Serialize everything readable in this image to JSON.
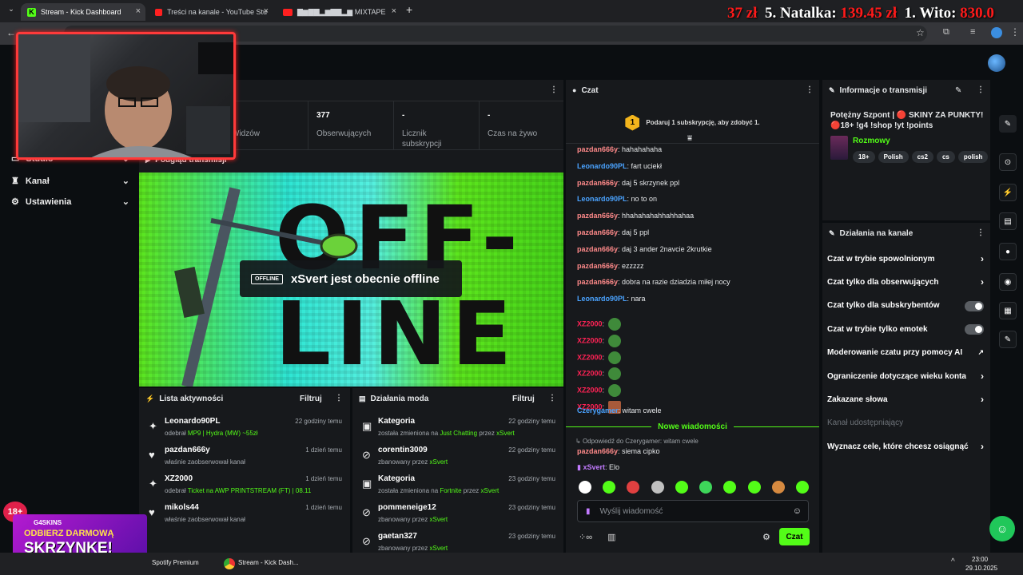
{
  "browser": {
    "tabs": [
      {
        "title": "Stream - Kick Dashboard",
        "active": true
      },
      {
        "title": "Treści na kanale - YouTube Stu",
        "active": false
      },
      {
        "title": "▇▆▇▇▂▆▇▇▂▆ MIXTAPE",
        "active": false
      }
    ],
    "new_tab": "+",
    "rank_overlay": {
      "seg1_amount": "37 zł",
      "seg2_label": "5. Natalka:",
      "seg2_amount": "139.45 zł",
      "seg3_label": "1. Wito:",
      "seg3_amount": "830.0"
    }
  },
  "stats": [
    {
      "value": "",
      "label": "Widzów"
    },
    {
      "value": "377",
      "label": "Obserwujących"
    },
    {
      "value": "-",
      "label": "Licznik subskrypcji"
    },
    {
      "value": "-",
      "label": "Czas na żywo"
    }
  ],
  "nav": {
    "items": [
      {
        "label": "Studio"
      },
      {
        "label": "Kanał"
      },
      {
        "label": "Ustawienia"
      }
    ]
  },
  "preview": {
    "title": "Podgląd transmisji",
    "offline_tag": "OFFLINE",
    "offline_text": "xSvert jest obecnie offline",
    "bg_text_1": "OFF-",
    "bg_text_2": "LINE"
  },
  "activity": {
    "title": "Lista aktywności",
    "filter": "Filtruj",
    "items": [
      {
        "name": "Leonardo90PL",
        "time": "22 godziny temu",
        "pre": "odebrał ",
        "hl": "MP9 | Hydra (MW) ~55zł"
      },
      {
        "name": "pazdan666y",
        "time": "1 dzień temu",
        "pre": "właśnie zaobserwował kanał",
        "hl": ""
      },
      {
        "name": "XZ2000",
        "time": "1 dzień temu",
        "pre": "odebrał ",
        "hl": "Ticket na AWP PRINTSTREAM (FT) | 08.11"
      },
      {
        "name": "mikols44",
        "time": "1 dzień temu",
        "pre": "właśnie zaobserwował kanał",
        "hl": ""
      }
    ]
  },
  "modactions": {
    "title": "Działania moda",
    "filter": "Filtruj",
    "items": [
      {
        "name": "Kategoria",
        "time": "22 godziny temu",
        "pre": "została zmieniona na ",
        "hl": "Just Chatting",
        "mid": " przez ",
        "hl2": "xSvert"
      },
      {
        "name": "corentin3009",
        "time": "22 godziny temu",
        "pre": "zbanowany przez ",
        "hl": "xSvert",
        "mid": "",
        "hl2": ""
      },
      {
        "name": "Kategoria",
        "time": "23 godziny temu",
        "pre": "została zmieniona na ",
        "hl": "Fortnite",
        "mid": " przez ",
        "hl2": "xSvert"
      },
      {
        "name": "pommeneige12",
        "time": "23 godziny temu",
        "pre": "zbanowany przez ",
        "hl": "xSvert",
        "mid": "",
        "hl2": ""
      },
      {
        "name": "gaetan327",
        "time": "23 godziny temu",
        "pre": "zbanowany przez ",
        "hl": "xSvert",
        "mid": "",
        "hl2": ""
      }
    ]
  },
  "chat": {
    "title": "Czat",
    "sub_banner": "Podaruj 1 subskrypcję, aby zdobyć 1.",
    "sub_badge": "1",
    "messages": [
      {
        "user": "pazdan666y",
        "cls": "u-red",
        "text": "hahahahaha"
      },
      {
        "user": "Leonardo90PL",
        "cls": "u-blue",
        "text": "fart uciekł"
      },
      {
        "user": "pazdan666y",
        "cls": "u-red",
        "text": "daj 5 skrzynek ppl"
      },
      {
        "user": "Leonardo90PL",
        "cls": "u-blue",
        "text": "no to on"
      },
      {
        "user": "pazdan666y",
        "cls": "u-red",
        "text": "hhahahahahhahhahaa"
      },
      {
        "user": "pazdan666y",
        "cls": "u-red",
        "text": "daj 5 ppl"
      },
      {
        "user": "pazdan666y",
        "cls": "u-red",
        "text": "daj 3 ander 2navcie 2krutkie"
      },
      {
        "user": "pazdan666y",
        "cls": "u-red",
        "text": "ezzzzz"
      },
      {
        "user": "pazdan666y",
        "cls": "u-red",
        "text": "dobra na razie dziadzia miłej nocy"
      },
      {
        "user": "Leonardo90PL",
        "cls": "u-blue",
        "text": "nara"
      },
      {
        "user": "XZ2000",
        "cls": "u-xz",
        "text": ""
      },
      {
        "user": "XZ2000",
        "cls": "u-xz",
        "text": ""
      },
      {
        "user": "XZ2000",
        "cls": "u-xz",
        "text": ""
      },
      {
        "user": "XZ2000",
        "cls": "u-xz",
        "text": ""
      },
      {
        "user": "XZ2000",
        "cls": "u-xz",
        "text": ""
      },
      {
        "user": "XZ2000",
        "cls": "u-xz",
        "text": ""
      },
      {
        "user": "Czerygamer",
        "cls": "u-blue",
        "text": "witam cwele"
      }
    ],
    "new_messages": "Nowe wiadomości",
    "reply_to": "Odpowiedź do Czerygamer: witam cwele",
    "reply_user": "pazdan666y",
    "reply_text": "siema cipko",
    "last_user": "xSvert",
    "last_text": "Elo",
    "input_placeholder": "Wyślij wiadomość",
    "send": "Czat"
  },
  "info": {
    "title": "Informacje o transmisji",
    "stream_title": "Potężny Szpont | 🔴 SKINY ZA PUNKTY! 🔴18+ !g4 !shop !yt !points",
    "category": "Rozmowy",
    "tags": [
      "18+",
      "Polish",
      "cs2",
      "cs",
      "polish"
    ]
  },
  "channel_actions": {
    "title": "Działania na kanale",
    "items": [
      {
        "label": "Czat w trybie spowolnionym",
        "kind": "chevron"
      },
      {
        "label": "Czat tylko dla obserwujących",
        "kind": "chevron"
      },
      {
        "label": "Czat tylko dla subskrybentów",
        "kind": "toggle"
      },
      {
        "label": "Czat w trybie tylko emotek",
        "kind": "toggle"
      },
      {
        "label": "Moderowanie czatu przy pomocy AI",
        "kind": "link"
      },
      {
        "label": "Ograniczenie dotyczące wieku konta",
        "kind": "chevron"
      },
      {
        "label": "Zakazane słowa",
        "kind": "chevron"
      },
      {
        "label": "Kanał udostępniający",
        "kind": "disabled"
      },
      {
        "label": "Wyznacz cele, które chcesz osiągnąć",
        "kind": "chevron"
      }
    ]
  },
  "promo": {
    "brand": "G4SKINS",
    "line1": "ODBIERZ DARMOWĄ",
    "line2": "SKRZYNKĘ!",
    "age": "18+"
  },
  "taskbar": {
    "items": [
      "Spotify Premium",
      "Stream - Kick Dash..."
    ],
    "time": "23:00",
    "date": "29.10.2025"
  },
  "colors": {
    "accent": "#53fc18",
    "panel": "#17191c",
    "bg": "#0b0e11"
  }
}
